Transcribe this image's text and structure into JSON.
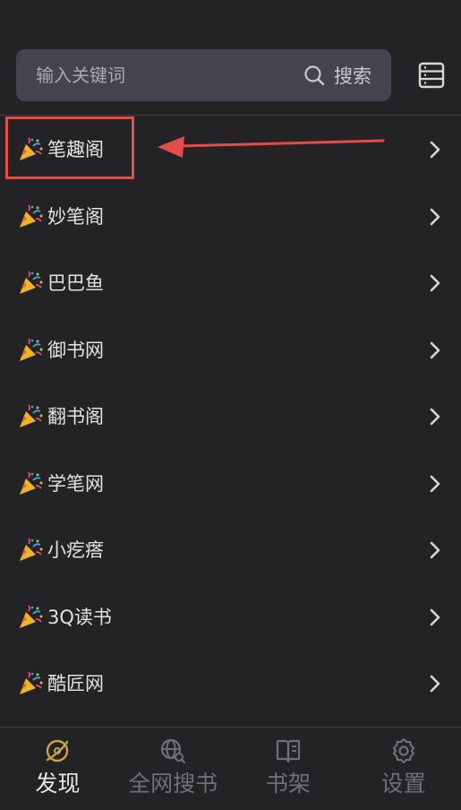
{
  "search": {
    "placeholder": "输入关键词",
    "button_label": "搜索"
  },
  "sources": [
    {
      "label": "笔趣阁",
      "icon": "party-popper-icon"
    },
    {
      "label": "妙笔阁",
      "icon": "party-popper-icon"
    },
    {
      "label": "巴巴鱼",
      "icon": "party-popper-icon"
    },
    {
      "label": "御书网",
      "icon": "party-popper-icon"
    },
    {
      "label": "翻书阁",
      "icon": "party-popper-icon"
    },
    {
      "label": "学笔网",
      "icon": "party-popper-icon"
    },
    {
      "label": "小疙瘩",
      "icon": "party-popper-icon"
    },
    {
      "label": "3Q读书",
      "icon": "party-popper-icon"
    },
    {
      "label": "酷匠网",
      "icon": "party-popper-icon"
    }
  ],
  "bottom_nav": {
    "items": [
      {
        "label": "发现",
        "icon": "discover-icon",
        "active": true
      },
      {
        "label": "全网搜书",
        "icon": "globe-search-icon",
        "active": false
      },
      {
        "label": "书架",
        "icon": "book-icon",
        "active": false
      },
      {
        "label": "设置",
        "icon": "gear-icon",
        "active": false
      }
    ]
  },
  "colors": {
    "background": "#232326",
    "search_bg": "#43444e",
    "annotation": "#e54b4b",
    "active_icon": "#c9a24a",
    "inactive": "#6f7077"
  }
}
